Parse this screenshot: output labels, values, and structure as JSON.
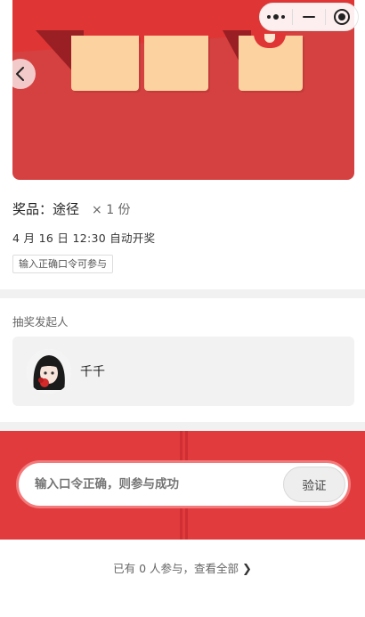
{
  "header": {
    "back_icon": "chevron-left-icon",
    "capsule": {
      "more_icon": "more-dots-icon",
      "minimize_icon": "minimize-icon",
      "close_icon": "target-close-icon"
    }
  },
  "banner": {
    "colors": {
      "background": "#d54040",
      "ticket": "#fbd2a0",
      "fold": "#9a1f24"
    }
  },
  "prize": {
    "label": "奖品：途径",
    "quantity": "× 1 份",
    "draw_time": "4 月 16 日 12:30 自动开奖",
    "tag": "输入正确口令可参与"
  },
  "initiator": {
    "section_title": "抽奖发起人",
    "name": "千千",
    "avatar_icon": "user-avatar"
  },
  "code_entry": {
    "placeholder": "输入口令正确，则参与成功",
    "verify_label": "验证",
    "colors": {
      "panel": "#e23b3d",
      "border": "#f27a7b"
    }
  },
  "participants": {
    "text": "已有  0  人参与，查看全部",
    "chevron_icon": "chevron-right-icon"
  }
}
